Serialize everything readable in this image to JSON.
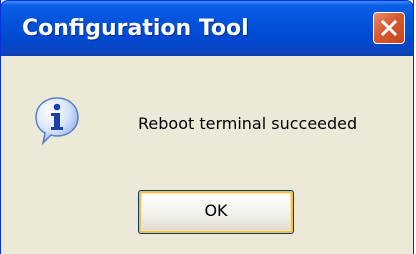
{
  "dialog": {
    "title": "Configuration Tool",
    "message": "Reboot terminal succeeded",
    "ok_label": "OK"
  },
  "colors": {
    "titlebar": "#0252da",
    "body": "#ece9d8",
    "close_button": "#d65a31"
  },
  "icons": {
    "dialog_icon": "info-icon",
    "close": "close-icon"
  }
}
